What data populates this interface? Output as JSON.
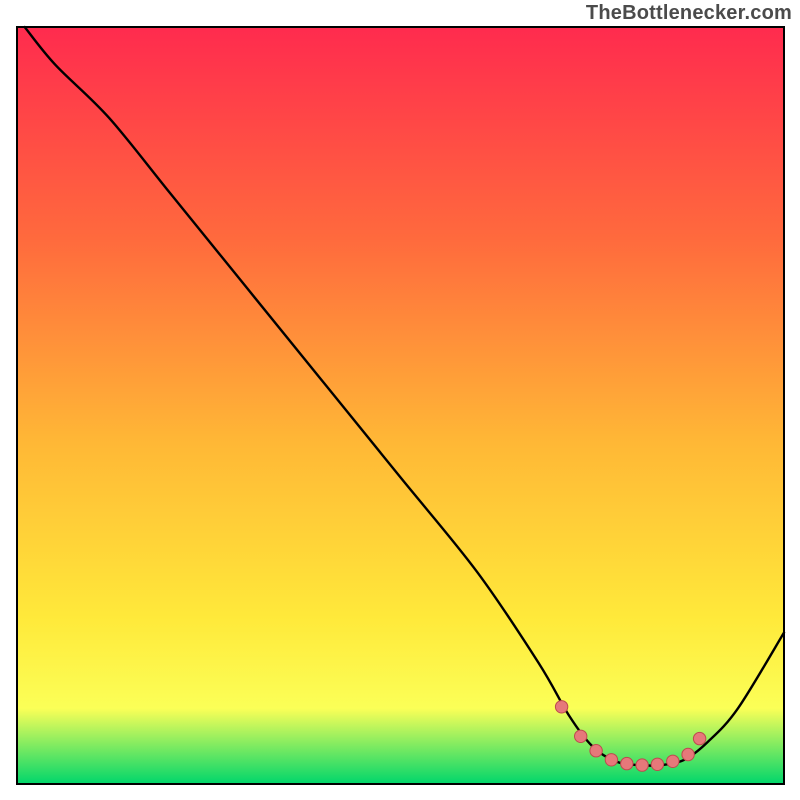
{
  "attribution": "TheBottlenecker.com",
  "colors": {
    "gradient_top": "#ff2b4e",
    "gradient_mid1": "#ff6a3d",
    "gradient_mid2": "#ffb836",
    "gradient_mid3": "#ffe93a",
    "gradient_mid4": "#fbff57",
    "gradient_bottom": "#00d66b",
    "curve": "#000000",
    "marker_fill": "#e6787a",
    "marker_stroke": "#bd4a4e",
    "border": "#000000"
  },
  "chart_data": {
    "type": "line",
    "title": "",
    "xlabel": "",
    "ylabel": "",
    "xlim": [
      0,
      100
    ],
    "ylim": [
      0,
      100
    ],
    "grid": false,
    "legend": false,
    "series": [
      {
        "name": "bottleneck-curve",
        "x": [
          1,
          5,
          12,
          20,
          30,
          40,
          50,
          60,
          68,
          72,
          75,
          78,
          81,
          84,
          87,
          90,
          94,
          100
        ],
        "y": [
          100,
          95,
          88,
          78,
          65.5,
          53,
          40.5,
          28,
          16,
          9,
          5,
          3,
          2.5,
          2.5,
          3.2,
          5.5,
          10,
          20
        ]
      }
    ],
    "markers": {
      "name": "optimal-zone",
      "x": [
        71,
        73.5,
        75.5,
        77.5,
        79.5,
        81.5,
        83.5,
        85.5,
        87.5,
        89
      ],
      "y": [
        10.2,
        6.3,
        4.4,
        3.2,
        2.7,
        2.5,
        2.6,
        3.0,
        3.9,
        6.0
      ]
    }
  }
}
